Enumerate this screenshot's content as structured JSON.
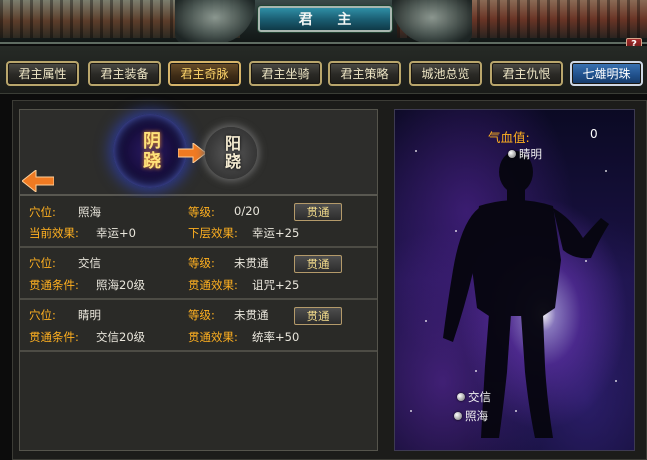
{
  "window": {
    "title": "君 主",
    "help_label": "?"
  },
  "tabs": [
    {
      "label": "君主属性",
      "state": "normal"
    },
    {
      "label": "君主装备",
      "state": "normal"
    },
    {
      "label": "君主奇脉",
      "state": "active"
    },
    {
      "label": "君主坐骑",
      "state": "normal"
    },
    {
      "label": "君主策略",
      "state": "normal"
    },
    {
      "label": "城池总览",
      "state": "normal"
    },
    {
      "label": "君主仇恨",
      "state": "normal"
    },
    {
      "label": "七雄明珠",
      "state": "highlight"
    }
  ],
  "meridian": {
    "current": "阴跷",
    "next": "阳跷",
    "prev_arrow_icon": "arrow-left-icon",
    "next_arrow_icon": "arrow-right-icon"
  },
  "acupoints": [
    {
      "label1": "穴位:",
      "name": "照海",
      "label2": "等级:",
      "level": "0/20",
      "label3": "当前效果:",
      "effect": "幸运+0",
      "label4": "下层效果:",
      "effect2": "幸运+25",
      "button": "贯通"
    },
    {
      "label1": "穴位:",
      "name": "交信",
      "label2": "等级:",
      "level": "未贯通",
      "label3": "贯通条件:",
      "effect": "照海20级",
      "label4": "贯通效果:",
      "effect2": "诅咒+25",
      "button": "贯通"
    },
    {
      "label1": "穴位:",
      "name": "睛明",
      "label2": "等级:",
      "level": "未贯通",
      "label3": "贯通条件:",
      "effect": "交信20级",
      "label4": "贯通效果:",
      "effect2": "统率+50",
      "button": "贯通"
    }
  ],
  "figure": {
    "qixue_label": "气血值:",
    "qixue_value": "0",
    "points": [
      {
        "name": "睛明"
      },
      {
        "name": "交信"
      },
      {
        "name": "照海"
      }
    ]
  }
}
